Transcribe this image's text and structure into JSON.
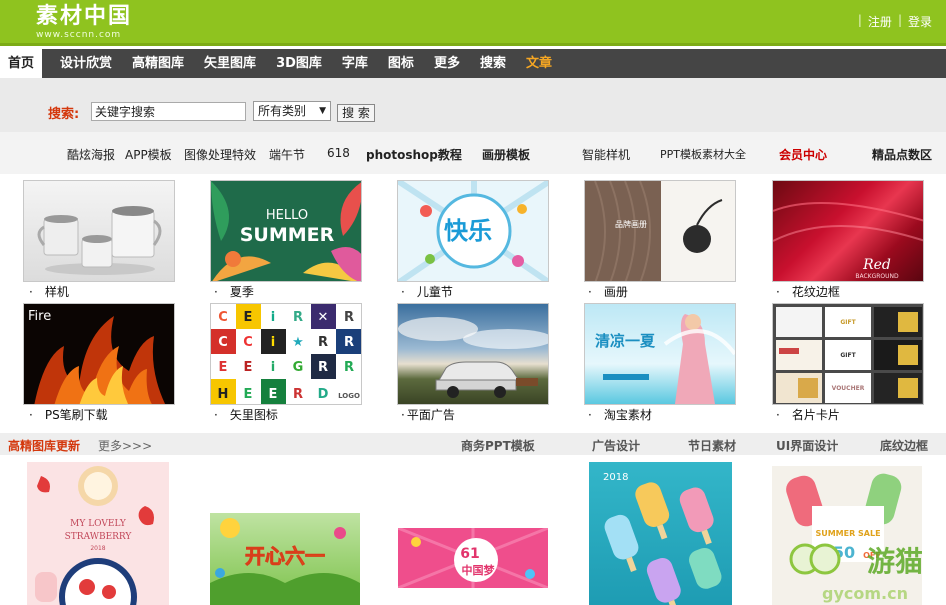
{
  "site": {
    "logo_text": "素材中国",
    "logo_sub": "www.sccnn.com",
    "register": "注册",
    "login": "登录",
    "separator": "|"
  },
  "nav": {
    "items": [
      "首页",
      "设计欣赏",
      "高精图库",
      "矢里图库",
      "3D图库",
      "字库",
      "图标",
      "更多",
      "搜索",
      "文章"
    ]
  },
  "search": {
    "label": "搜索:",
    "input_value": "关键字搜索",
    "category": "所有类别",
    "button": "搜 索"
  },
  "keywords": [
    "酷炫海报",
    "APP模板",
    "图像处理特效",
    "端午节",
    "618",
    "photoshop教程",
    "画册模板",
    "智能样机",
    "PPT模板素材大全",
    "会员中心",
    "精品点数区"
  ],
  "gallery": {
    "bullet": "·",
    "row1": [
      "样机",
      "夏季",
      "儿童节",
      "画册",
      "花纹边框"
    ],
    "row2": [
      "PS笔刷下载",
      "矢里图标",
      "平面广告",
      "淘宝素材",
      "名片卡片"
    ]
  },
  "thumb_text": {
    "summer_hello": "HELLO",
    "summer": "SUMMER",
    "kids": "快乐",
    "brochure": "品牌画册",
    "red": "Red",
    "red_sub": "BACKGROUND",
    "fire": "Fire",
    "ad_summer": "清凉一夏",
    "logo_sample": "LOGO",
    "gift": "GIFT",
    "voucher": "VOUCHER"
  },
  "section": {
    "title": "高精图库更新",
    "more": "更多>>>",
    "links": [
      "商务PPT模板",
      "广告设计",
      "节日素材",
      "UI界面设计",
      "底纹边框"
    ]
  },
  "bottom_text": {
    "strawberry_line1": "MY LOVELY",
    "strawberry_line2": "STRAWBERRY",
    "strawberry_year": "2018",
    "kids_banner": "开心六一",
    "pink_banner": "中国梦",
    "pink_61": "61",
    "summer_sale": "SUMMER SALE",
    "pct": "50",
    "off": "OFF",
    "ice_year": "2018"
  },
  "watermark": {
    "text": "游猫",
    "sub": "gycom.cn"
  },
  "colors": {
    "header_green": "#8fc31f",
    "nav_dark": "#454545",
    "accent_red": "#d4380d",
    "accent_orange": "#f5a623"
  }
}
